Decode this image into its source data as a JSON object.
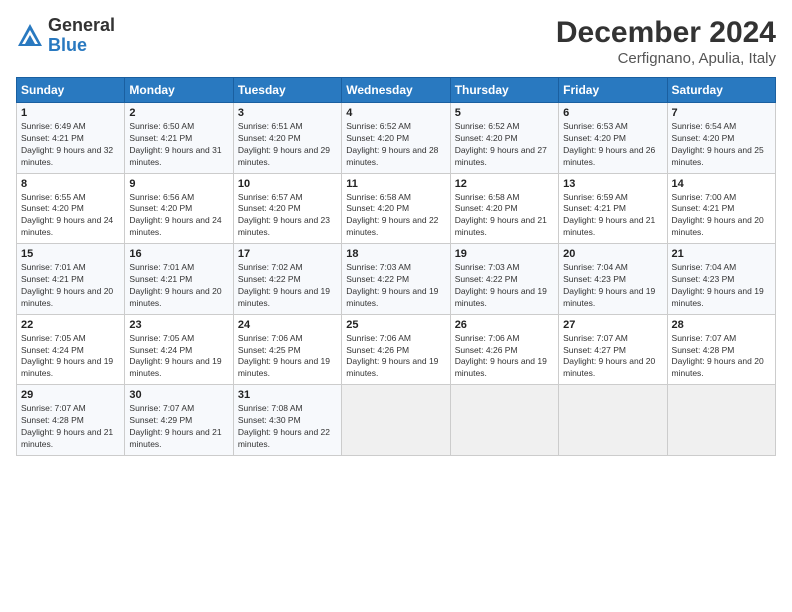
{
  "logo": {
    "general": "General",
    "blue": "Blue"
  },
  "title": "December 2024",
  "subtitle": "Cerfignano, Apulia, Italy",
  "days_header": [
    "Sunday",
    "Monday",
    "Tuesday",
    "Wednesday",
    "Thursday",
    "Friday",
    "Saturday"
  ],
  "weeks": [
    [
      {
        "day": "1",
        "sunrise": "6:49 AM",
        "sunset": "4:21 PM",
        "daylight": "9 hours and 32 minutes."
      },
      {
        "day": "2",
        "sunrise": "6:50 AM",
        "sunset": "4:21 PM",
        "daylight": "9 hours and 31 minutes."
      },
      {
        "day": "3",
        "sunrise": "6:51 AM",
        "sunset": "4:20 PM",
        "daylight": "9 hours and 29 minutes."
      },
      {
        "day": "4",
        "sunrise": "6:52 AM",
        "sunset": "4:20 PM",
        "daylight": "9 hours and 28 minutes."
      },
      {
        "day": "5",
        "sunrise": "6:52 AM",
        "sunset": "4:20 PM",
        "daylight": "9 hours and 27 minutes."
      },
      {
        "day": "6",
        "sunrise": "6:53 AM",
        "sunset": "4:20 PM",
        "daylight": "9 hours and 26 minutes."
      },
      {
        "day": "7",
        "sunrise": "6:54 AM",
        "sunset": "4:20 PM",
        "daylight": "9 hours and 25 minutes."
      }
    ],
    [
      {
        "day": "8",
        "sunrise": "6:55 AM",
        "sunset": "4:20 PM",
        "daylight": "9 hours and 24 minutes."
      },
      {
        "day": "9",
        "sunrise": "6:56 AM",
        "sunset": "4:20 PM",
        "daylight": "9 hours and 24 minutes."
      },
      {
        "day": "10",
        "sunrise": "6:57 AM",
        "sunset": "4:20 PM",
        "daylight": "9 hours and 23 minutes."
      },
      {
        "day": "11",
        "sunrise": "6:58 AM",
        "sunset": "4:20 PM",
        "daylight": "9 hours and 22 minutes."
      },
      {
        "day": "12",
        "sunrise": "6:58 AM",
        "sunset": "4:20 PM",
        "daylight": "9 hours and 21 minutes."
      },
      {
        "day": "13",
        "sunrise": "6:59 AM",
        "sunset": "4:21 PM",
        "daylight": "9 hours and 21 minutes."
      },
      {
        "day": "14",
        "sunrise": "7:00 AM",
        "sunset": "4:21 PM",
        "daylight": "9 hours and 20 minutes."
      }
    ],
    [
      {
        "day": "15",
        "sunrise": "7:01 AM",
        "sunset": "4:21 PM",
        "daylight": "9 hours and 20 minutes."
      },
      {
        "day": "16",
        "sunrise": "7:01 AM",
        "sunset": "4:21 PM",
        "daylight": "9 hours and 20 minutes."
      },
      {
        "day": "17",
        "sunrise": "7:02 AM",
        "sunset": "4:22 PM",
        "daylight": "9 hours and 19 minutes."
      },
      {
        "day": "18",
        "sunrise": "7:03 AM",
        "sunset": "4:22 PM",
        "daylight": "9 hours and 19 minutes."
      },
      {
        "day": "19",
        "sunrise": "7:03 AM",
        "sunset": "4:22 PM",
        "daylight": "9 hours and 19 minutes."
      },
      {
        "day": "20",
        "sunrise": "7:04 AM",
        "sunset": "4:23 PM",
        "daylight": "9 hours and 19 minutes."
      },
      {
        "day": "21",
        "sunrise": "7:04 AM",
        "sunset": "4:23 PM",
        "daylight": "9 hours and 19 minutes."
      }
    ],
    [
      {
        "day": "22",
        "sunrise": "7:05 AM",
        "sunset": "4:24 PM",
        "daylight": "9 hours and 19 minutes."
      },
      {
        "day": "23",
        "sunrise": "7:05 AM",
        "sunset": "4:24 PM",
        "daylight": "9 hours and 19 minutes."
      },
      {
        "day": "24",
        "sunrise": "7:06 AM",
        "sunset": "4:25 PM",
        "daylight": "9 hours and 19 minutes."
      },
      {
        "day": "25",
        "sunrise": "7:06 AM",
        "sunset": "4:26 PM",
        "daylight": "9 hours and 19 minutes."
      },
      {
        "day": "26",
        "sunrise": "7:06 AM",
        "sunset": "4:26 PM",
        "daylight": "9 hours and 19 minutes."
      },
      {
        "day": "27",
        "sunrise": "7:07 AM",
        "sunset": "4:27 PM",
        "daylight": "9 hours and 20 minutes."
      },
      {
        "day": "28",
        "sunrise": "7:07 AM",
        "sunset": "4:28 PM",
        "daylight": "9 hours and 20 minutes."
      }
    ],
    [
      {
        "day": "29",
        "sunrise": "7:07 AM",
        "sunset": "4:28 PM",
        "daylight": "9 hours and 21 minutes."
      },
      {
        "day": "30",
        "sunrise": "7:07 AM",
        "sunset": "4:29 PM",
        "daylight": "9 hours and 21 minutes."
      },
      {
        "day": "31",
        "sunrise": "7:08 AM",
        "sunset": "4:30 PM",
        "daylight": "9 hours and 22 minutes."
      },
      null,
      null,
      null,
      null
    ]
  ],
  "labels": {
    "sunrise": "Sunrise:",
    "sunset": "Sunset:",
    "daylight": "Daylight:"
  }
}
